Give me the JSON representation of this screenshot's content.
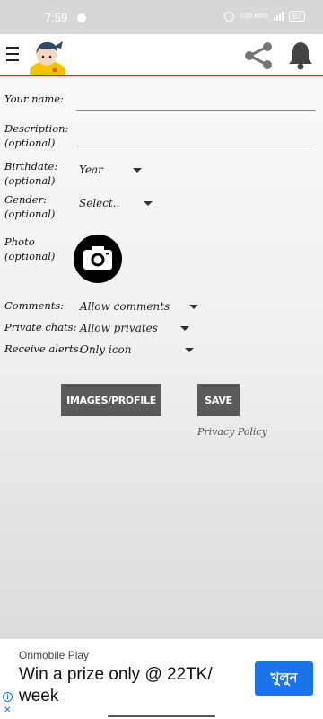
{
  "status_bar": {
    "time": "7:59",
    "network_speed": "0.00 KB/S",
    "battery": "67"
  },
  "app_bar": {
    "icons": [
      "menu-icon",
      "avatar",
      "share-icon",
      "bell-icon"
    ],
    "accent_color": "#e02020"
  },
  "form": {
    "name": {
      "label": "Your name:",
      "value": ""
    },
    "description": {
      "label": "Description:",
      "hint": "(optional)",
      "value": ""
    },
    "birthdate": {
      "label": "Birthdate:",
      "hint": "(optional)",
      "selected": "Year"
    },
    "gender": {
      "label": "Gender:",
      "hint": "(optional)",
      "selected": "Select.."
    },
    "photo": {
      "label": "Photo",
      "hint": "(optional)"
    },
    "comments": {
      "label": "Comments:",
      "selected": "Allow comments"
    },
    "private_chats": {
      "label": "Private chats:",
      "selected": "Allow privates"
    },
    "receive_alerts": {
      "label": "Receive alerts:",
      "selected": "Only icon"
    }
  },
  "actions": {
    "images_profile": "IMAGES/PROFILE",
    "save": "SAVE",
    "privacy_policy": "Privacy Policy"
  },
  "ad": {
    "sponsor": "Onmobile Play",
    "headline": "Win a prize only @ 22TK/ week",
    "cta": "খুলুন",
    "cta_color": "#1a73e8"
  }
}
